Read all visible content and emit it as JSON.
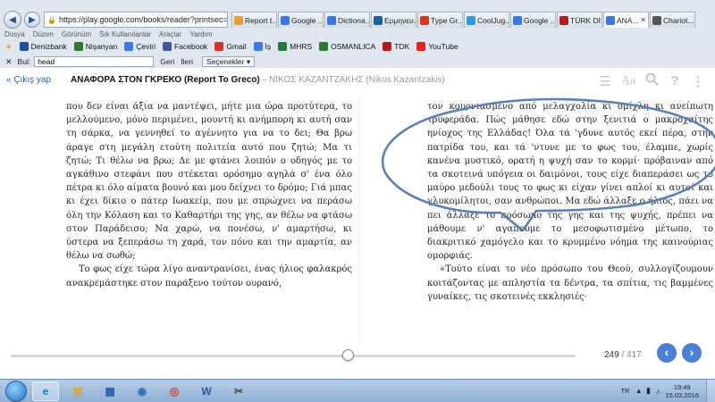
{
  "browser": {
    "url": "https://play.google.com/books/reader?printsec=fr",
    "tabs": [
      {
        "label": "Report t...",
        "icon": "google-books-icon",
        "color": "#e8a13a",
        "active": false
      },
      {
        "label": "Google ...",
        "icon": "google-icon",
        "color": "#3b78e7",
        "active": false
      },
      {
        "label": "Dictiona...",
        "icon": "dictionary-icon",
        "color": "#3b78e7",
        "active": false
      },
      {
        "label": "Ερμηνευ...",
        "icon": "lexicon-icon",
        "color": "#1f5f9f",
        "active": false
      },
      {
        "label": "Type Gr...",
        "icon": "type-greek-icon",
        "color": "#d9371c",
        "active": false
      },
      {
        "label": "CoolJug...",
        "icon": "cooljugator-icon",
        "color": "#2e9bd6",
        "active": false
      },
      {
        "label": "Google ...",
        "icon": "google-icon",
        "color": "#3b78e7",
        "active": false
      },
      {
        "label": "TÜRK Dİ...",
        "icon": "tdk-icon",
        "color": "#b31b1b",
        "active": false
      },
      {
        "label": "ΑΝΑ...",
        "icon": "google-books-icon",
        "color": "#3b78e7",
        "active": true
      },
      {
        "label": "Chariot...",
        "icon": "wikipedia-icon",
        "color": "#555555",
        "active": false
      }
    ],
    "menu": [
      "Dosya",
      "Düzen",
      "Görünüm",
      "Sık Kullanılanlar",
      "Araçlar",
      "Yardım"
    ],
    "bookmarks": [
      {
        "label": "Denizbank",
        "icon": "denizbank-icon",
        "color": "#1c4fa0"
      },
      {
        "label": "Nişanyan",
        "icon": "nisanyan-icon",
        "color": "#2d7a2d"
      },
      {
        "label": "Çeviri",
        "icon": "translate-icon",
        "color": "#3b78e7"
      },
      {
        "label": "Facebook",
        "icon": "facebook-icon",
        "color": "#3b5998"
      },
      {
        "label": "Gmail",
        "icon": "gmail-icon",
        "color": "#d93025"
      },
      {
        "label": "İş",
        "icon": "work-icon",
        "color": "#3b78e7"
      },
      {
        "label": "MHRS",
        "icon": "mhrs-icon",
        "color": "#1f7a3f"
      },
      {
        "label": "OSMANLICA",
        "icon": "osmanlica-icon",
        "color": "#2d7a2d"
      },
      {
        "label": "TDK",
        "icon": "tdk-icon",
        "color": "#b31b1b"
      },
      {
        "label": "YouTube",
        "icon": "youtube-icon",
        "color": "#e62117"
      }
    ],
    "find": {
      "label": "Bul:",
      "value": "head",
      "back": "Geri",
      "next": "İleri",
      "options": "Seçenekler"
    }
  },
  "reader": {
    "exit_label": "« Çıkış yap",
    "title": "ΑΝΑΦΟΡΑ ΣΤΟΝ ΓΚΡΕΚΟ (Report To Greco)",
    "author": "– ΝΙΚΟΣ ΚΑΖΑΝΤΖΑΚΗΣ (Nikos Kazantzakis)",
    "tools": [
      "contents-icon",
      "font-settings-icon",
      "search-icon",
      "help-icon",
      "more-icon"
    ],
    "font_settings_label": "Aa",
    "left_page": [
      "που δεν είναι άξια να μαντέψει, μήτε μια ώρα προτύτερα, το μελλούμενο, μόνο περιμένει, μουντή κι ανήμπορη κι αυτή σαν τη σάρκα, να γεννηθεί το αγέννητο για να το δει; Θα βρω άραγε στη μεγάλη ετούτη πολιτεία αυτό που ζητώ; Μα τι ζητώ; Τι θέλω να βρω; Δε με φτάνει λοιπόν ο οδηγός με το αγκάθινο στεφάνι που στέκεται ορόσημο αγηλά σ' ένα όλο πέτρα κι όλο αίματα βουνό και μου δείχνει το δρόμο; Γιά μπας κι έχει δίκιο ο πάτερ Ιωακείμ, που με σπρώχνει να περάσω όλη την Κόλαση και το Καθαρτήρι της γης, αν θέλω να φτάσω στον Παράδεισο; Να χαρώ, να πονέσω, ν' αμαρτήσω, κι ύστερα να ξεπεράσω τη χαρά, τον πόνο και την αμαρτία, αν θέλω να σωθώ;",
      "Το φως είχε τώρα λίγο αναντρανίσει, ένας ήλιος φαλακρός ανακρεμάστηκε στον παράξενο τούτον ουρανό,"
    ],
    "right_page": [
      "τον κουρνιασμένο από μελαγχολία κι ομίχλη κι ανείπωτη τρυφεράδα. Πώς μάθησε εδώ στην ξενιτιά ο μακροχαίτης ηνίοχος της Ελλάδας! Όλα τά 'γδυνε αυτός εκεί πέρα, στην πατρίδα του, και τά 'ντυνε με το φως του, έλαμπε, χωρίς κανένα μυστικό, ορατή η ψυχή σαν το κορμί· πρόβαιναν από τα σκοτεινά υπόγεια οι δαιμόνοι, τους είχε διαπεράσει ως το μαύρο μεδούλι τους το φως κι είχαν γίνει απλοί κι αυτοί και γλυκομίλητοι, σαν ανθρώποι. Μα εδώ άλλαξε ο ήλιος, πάει να πει άλλαξε το πρόσωπο της γης και της ψυχής, πρέπει να μάθουμε ν' αγαπούμε το μεσοφωτισμένο μέτωπο, το διακριτικό χαμόγελο και το κρυμμένο νόημα της καινούριας ομορφιάς.",
      "«Τούτο είναι το νέο πρόσωπο του Θεού, συλλογίζουμουν κοιτάζοντας με απληστία τα δέντρα, τα σπίτια, τις βαμμένες γυναίκες, τις σκοτεινές εκκλησιές·"
    ],
    "progress": {
      "current": "249",
      "separator": " / ",
      "total": "417",
      "fraction": 0.597
    },
    "prev_icon": "chevron-left-icon",
    "next_icon": "chevron-right-icon"
  },
  "taskbar": {
    "items": [
      "internet-explorer-icon",
      "file-explorer-icon",
      "app-grid-icon",
      "google-earth-icon",
      "chrome-icon",
      "word-icon",
      "screenshot-tool-icon"
    ],
    "language": "TR",
    "time": "19:49",
    "date": "15.03.2016"
  }
}
